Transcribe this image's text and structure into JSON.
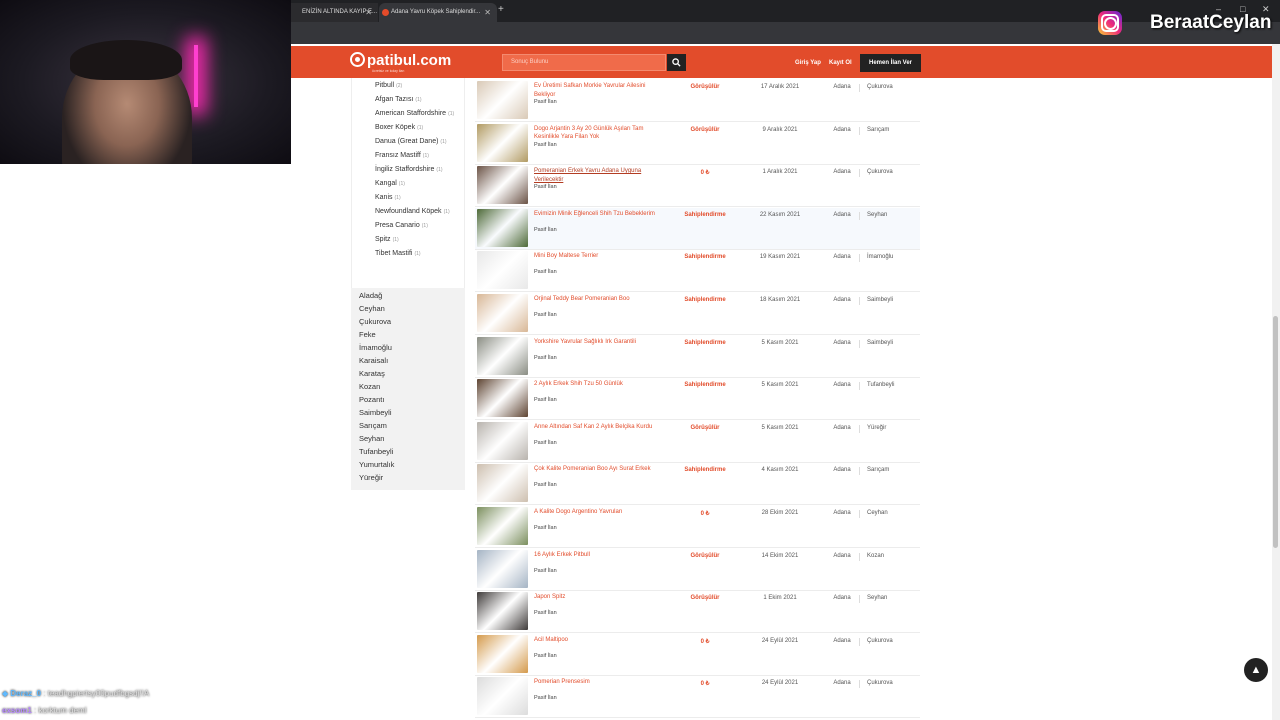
{
  "browser": {
    "tabs": [
      {
        "label": "ENİZİN ALTINDA KAYIP E..."
      },
      {
        "label": "Adana Yavru Köpek Sahiplendir..."
      }
    ]
  },
  "header": {
    "logo": "patibul.com",
    "logo_sub": "ücretsiz ve kolay ilan",
    "search_placeholder": "Sonuç Bulunu",
    "login": "Giriş Yap",
    "register": "Kayıt Ol",
    "cta": "Hemen İlan Ver"
  },
  "breeds": [
    {
      "name": "Pitbull",
      "count": "(2)"
    },
    {
      "name": "Afgan Tazısı",
      "count": "(1)"
    },
    {
      "name": "American Staffordshire",
      "count": "(1)"
    },
    {
      "name": "Boxer Köpek",
      "count": "(1)"
    },
    {
      "name": "Danua (Great Dane)",
      "count": "(1)"
    },
    {
      "name": "Fransız Mastiff",
      "count": "(1)"
    },
    {
      "name": "İngiliz Staffordshire",
      "count": "(1)"
    },
    {
      "name": "Kangal",
      "count": "(1)"
    },
    {
      "name": "Kanis",
      "count": "(1)"
    },
    {
      "name": "Newfoundland Köpek",
      "count": "(1)"
    },
    {
      "name": "Presa Canario",
      "count": "(1)"
    },
    {
      "name": "Spitz",
      "count": "(1)"
    },
    {
      "name": "Tibet Mastifi",
      "count": "(1)"
    }
  ],
  "districts": [
    "Aladağ",
    "Ceyhan",
    "Çukurova",
    "Feke",
    "İmamoğlu",
    "Karaisalı",
    "Karataş",
    "Kozan",
    "Pozantı",
    "Saimbeyli",
    "Sarıçam",
    "Seyhan",
    "Tufanbeyli",
    "Yumurtalık",
    "Yüreğir"
  ],
  "listings": [
    {
      "title": "Ev Üretimi Safkan Morkie Yavrular Ailesini Bekliyor",
      "status": "Pasif İlan",
      "price": "Görüşülür",
      "date": "17 Aralık 2021",
      "city": "Adana",
      "district": "Çukurova",
      "thumb": "#d9c9b6"
    },
    {
      "title": "Dogo Arjantin 3 Ay 20 Günlük Aşıları Tam Kesinlikle Yara Filan Yok",
      "status": "Pasif İlan",
      "price": "Görüşülür",
      "date": "9 Aralık 2021",
      "city": "Adana",
      "district": "Sarıçam",
      "thumb": "#b19a62"
    },
    {
      "title": "Pomeranian Erkek Yavru Adana Uyguna Verilecektir",
      "status": "Pasif İlan",
      "price": "0 ₺",
      "date": "1 Aralık 2021",
      "city": "Adana",
      "district": "Çukurova",
      "thumb": "#6b5346"
    },
    {
      "title": "Evimizin Minik Eğlenceli Shih Tzu Bebeklerim",
      "status": "Pasif İlan",
      "price": "Sahiplendirme",
      "date": "22 Kasım 2021",
      "city": "Adana",
      "district": "Seyhan",
      "thumb": "#4e6a38"
    },
    {
      "title": "Mini Boy Maltese Terrier",
      "status": "Pasif İlan",
      "price": "Sahiplendirme",
      "date": "19 Kasım 2021",
      "city": "Adana",
      "district": "İmamoğlu",
      "thumb": "#e8e8e8"
    },
    {
      "title": "Orjinal Teddy Bear Pomeranian Boo",
      "status": "Pasif İlan",
      "price": "Sahiplendirme",
      "date": "18 Kasım 2021",
      "city": "Adana",
      "district": "Saimbeyli",
      "thumb": "#d8b796"
    },
    {
      "title": "Yorkshire Yavrular Sağlıklı Irk Garantili",
      "status": "Pasif İlan",
      "price": "Sahiplendirme",
      "date": "5 Kasım 2021",
      "city": "Adana",
      "district": "Saimbeyli",
      "thumb": "#8a8d83"
    },
    {
      "title": "2 Aylık Erkek Shih Tzu 50 Günlük",
      "status": "Pasif İlan",
      "price": "Sahiplendirme",
      "date": "5 Kasım 2021",
      "city": "Adana",
      "district": "Tufanbeyli",
      "thumb": "#5e4432"
    },
    {
      "title": "Anne Altından Saf Kan 2 Aylık Belçika Kurdu",
      "status": "Pasif İlan",
      "price": "Görüşülür",
      "date": "5 Kasım 2021",
      "city": "Adana",
      "district": "Yüreğir",
      "thumb": "#b8b3ad"
    },
    {
      "title": "Çok Kalite Pomeranian Boo Ayı Surat Erkek",
      "status": "Pasif İlan",
      "price": "Sahiplendirme",
      "date": "4 Kasım 2021",
      "city": "Adana",
      "district": "Sarıçam",
      "thumb": "#cdbfaf"
    },
    {
      "title": "A Kalite Dogo Argentino Yavruları",
      "status": "Pasif İlan",
      "price": "0 ₺",
      "date": "28 Ekim 2021",
      "city": "Adana",
      "district": "Ceyhan",
      "thumb": "#7b8f5e"
    },
    {
      "title": "16 Aylık Erkek Pitbull",
      "status": "Pasif İlan",
      "price": "Görüşülür",
      "date": "14 Ekim 2021",
      "city": "Adana",
      "district": "Kozan",
      "thumb": "#a5b4c4"
    },
    {
      "title": "Japon Spitz",
      "status": "Pasif İlan",
      "price": "Görüşülür",
      "date": "1 Ekim 2021",
      "city": "Adana",
      "district": "Seyhan",
      "thumb": "#3f3b3a"
    },
    {
      "title": "Acil Maltipoo",
      "status": "Pasif İlan",
      "price": "0 ₺",
      "date": "24 Eylül 2021",
      "city": "Adana",
      "district": "Çukurova",
      "thumb": "#d49a4c"
    },
    {
      "title": "Pomerian Prensesim",
      "status": "Pasif İlan",
      "price": "0 ₺",
      "date": "24 Eylül 2021",
      "city": "Adana",
      "district": "Çukurova",
      "thumb": "#dcdcdc"
    }
  ],
  "overlay": {
    "handle": "BeraatCeylan",
    "chat": [
      {
        "user": "Deraz_0",
        "message": "teadhgpiertsy00pudfbgsdj!!A"
      },
      {
        "user": "exsom1",
        "message": "korktum deml"
      }
    ]
  },
  "colors": {
    "brand": "#e24c2b",
    "dark": "#222222"
  }
}
